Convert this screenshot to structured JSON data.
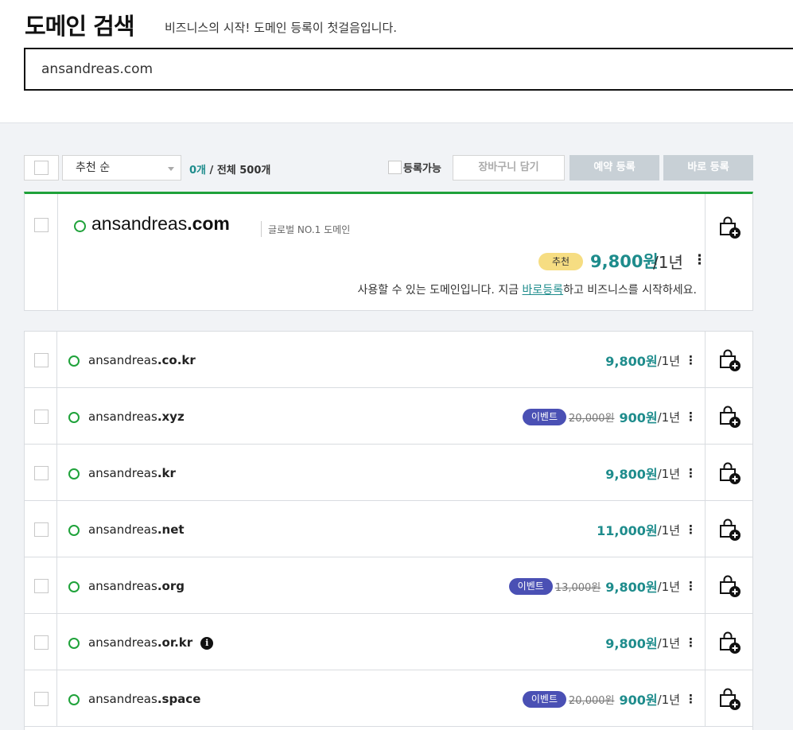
{
  "header": {
    "title": "도메인 검색",
    "subtitle": "비즈니스의 시작! 도메인 등록이 첫걸음입니다.",
    "search_value": "ansandreas.com"
  },
  "toolbar": {
    "sort_label": "추천 순",
    "selected_count": "0개",
    "total_count": "/ 전체 500개",
    "available_only_label": "등록가능",
    "cart_button": "장바구니 담기",
    "reserve_button": "예약 등록",
    "register_button": "바로 등록"
  },
  "featured": {
    "name_base": "ansandreas",
    "name_tld": ".com",
    "tag": "글로벌 NO.1 도메인",
    "badge": "추천",
    "price": "9,800원",
    "unit": "/1년",
    "more": "⋮",
    "message_prefix": "사용할 수 있는 도메인입니다. 지금 ",
    "message_link": "바로등록",
    "message_suffix": "하고 비즈니스를 시작하세요.",
    "status_color": "#1fa23a"
  },
  "rows": [
    {
      "base": "ansandreas",
      "tld": ".co.kr",
      "event": "",
      "original_price": "",
      "price": "9,800원",
      "unit": "/1년",
      "more": "⋮"
    },
    {
      "base": "ansandreas",
      "tld": ".xyz",
      "event": "이벤트",
      "original_price": "20,000원",
      "price": "900원",
      "unit": "/1년",
      "more": "⋮"
    },
    {
      "base": "ansandreas",
      "tld": ".kr",
      "event": "",
      "original_price": "",
      "price": "9,800원",
      "unit": "/1년",
      "more": "⋮"
    },
    {
      "base": "ansandreas",
      "tld": ".net",
      "event": "",
      "original_price": "",
      "price": "11,000원",
      "unit": "/1년",
      "more": "⋮"
    },
    {
      "base": "ansandreas",
      "tld": ".org",
      "event": "이벤트",
      "original_price": "13,000원",
      "price": "9,800원",
      "unit": "/1년",
      "more": "⋮"
    },
    {
      "base": "ansandreas",
      "tld": ".or.kr",
      "info": "i",
      "event": "",
      "original_price": "",
      "price": "9,800원",
      "unit": "/1년",
      "more": "⋮"
    },
    {
      "base": "ansandreas",
      "tld": ".space",
      "event": "이벤트",
      "original_price": "20,000원",
      "price": "900원",
      "unit": "/1년",
      "more": "⋮"
    }
  ],
  "icons": {
    "status": "available-circle-icon",
    "cart": "cart-add-icon",
    "more": "more-vertical-icon",
    "info": "info-icon"
  },
  "colors": {
    "accent_green": "#1fa23a",
    "price_teal": "#1e8c8c",
    "event_badge": "#4a50b4",
    "recommend_badge": "#f6dd82"
  }
}
